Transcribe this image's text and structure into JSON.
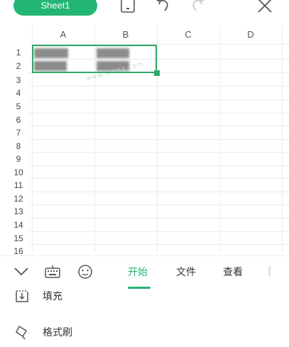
{
  "topbar": {
    "sheet_tab": "Sheet1",
    "icons": [
      "mobile-view-icon",
      "undo-icon",
      "redo-icon",
      "close-icon"
    ]
  },
  "grid": {
    "columns": [
      "A",
      "B",
      "C",
      "D"
    ],
    "rows": [
      "1",
      "2",
      "3",
      "4",
      "5",
      "6",
      "7",
      "8",
      "9",
      "10",
      "11",
      "12",
      "13",
      "14",
      "15",
      "16"
    ],
    "watermark": "www.xilinx.com"
  },
  "tabbar": {
    "tabs": [
      "开始",
      "文件",
      "查看"
    ],
    "active_tab": "开始",
    "icons": [
      "collapse-chevron-icon",
      "keyboard-icon",
      "emoji-icon"
    ]
  },
  "menu": {
    "items": [
      {
        "label": "填充",
        "icon": "fill-icon"
      },
      {
        "label": "格式刷",
        "icon": "format-painter-icon"
      }
    ]
  },
  "colors": {
    "accent": "#22b573",
    "selection": "#2fa86a"
  }
}
